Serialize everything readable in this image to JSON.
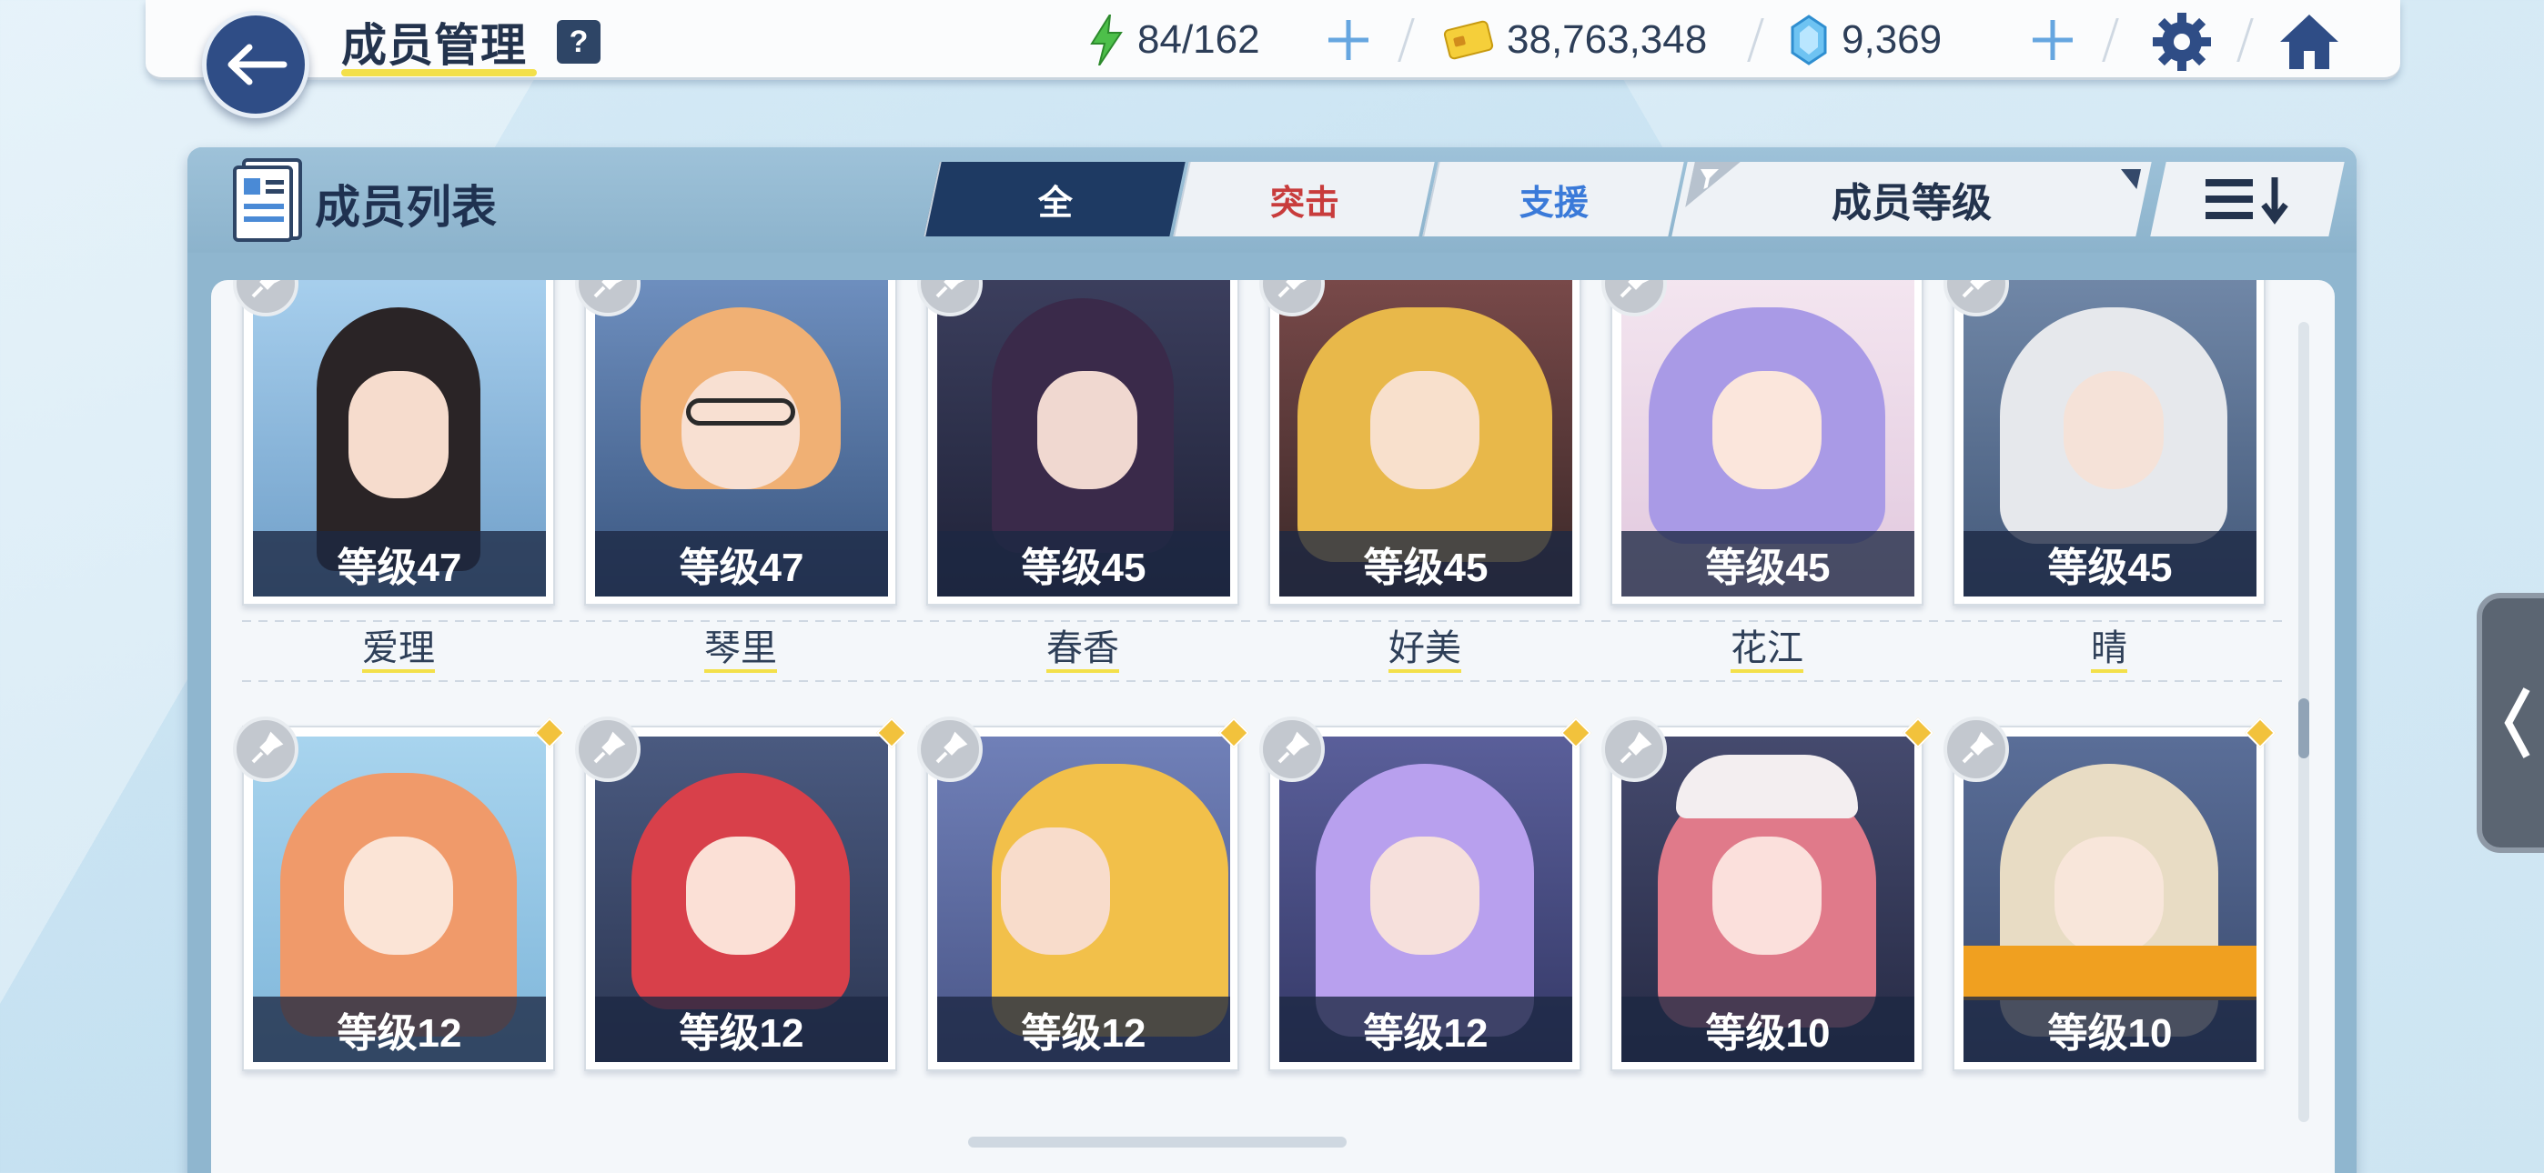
{
  "header": {
    "title": "成员管理",
    "help_icon": "question-mark-icon",
    "help_label": "?"
  },
  "resources": {
    "ap": {
      "value": "84/162",
      "icon": "lightning-icon"
    },
    "credits": {
      "value": "38,763,348",
      "icon": "credit-card-icon"
    },
    "gems": {
      "value": "9,369",
      "icon": "gem-icon"
    }
  },
  "panel": {
    "title": "成员列表",
    "tabs": [
      {
        "label": "全",
        "active": true
      },
      {
        "label": "突击",
        "active": false
      },
      {
        "label": "支援",
        "active": false
      }
    ],
    "sort_label": "成员等级"
  },
  "students": [
    {
      "name": "爱理",
      "level": "等级47",
      "hair": "#2a2426",
      "bg": "#7fb0d8"
    },
    {
      "name": "琴里",
      "level": "等级47",
      "hair": "#f0b074",
      "bg": "#4a6a9a"
    },
    {
      "name": "春香",
      "level": "等级45",
      "hair": "#3a2a4a",
      "bg": "#2b2f4a"
    },
    {
      "name": "好美",
      "level": "等级45",
      "hair": "#e8b84a",
      "bg": "#5a3a3a"
    },
    {
      "name": "花江",
      "level": "等级45",
      "hair": "#a99ae6",
      "bg": "#e9d8ea"
    },
    {
      "name": "晴",
      "level": "等级45",
      "hair": "#e6e8ec",
      "bg": "#5a7090"
    },
    {
      "name": "",
      "level": "等级12",
      "hair": "#f09a6a",
      "bg": "#8fc2e0"
    },
    {
      "name": "",
      "level": "等级12",
      "hair": "#d8404a",
      "bg": "#3a4668"
    },
    {
      "name": "",
      "level": "等级12",
      "hair": "#f2c04a",
      "bg": "#5e6fa8"
    },
    {
      "name": "",
      "level": "等级12",
      "hair": "#b8a0ee",
      "bg": "#4a4f88"
    },
    {
      "name": "",
      "level": "等级10",
      "hair": "#e07a8a",
      "bg": "#3a3f5e"
    },
    {
      "name": "",
      "level": "等级10",
      "hair": "#e8dcc4",
      "bg": "#4a5e88"
    }
  ]
}
